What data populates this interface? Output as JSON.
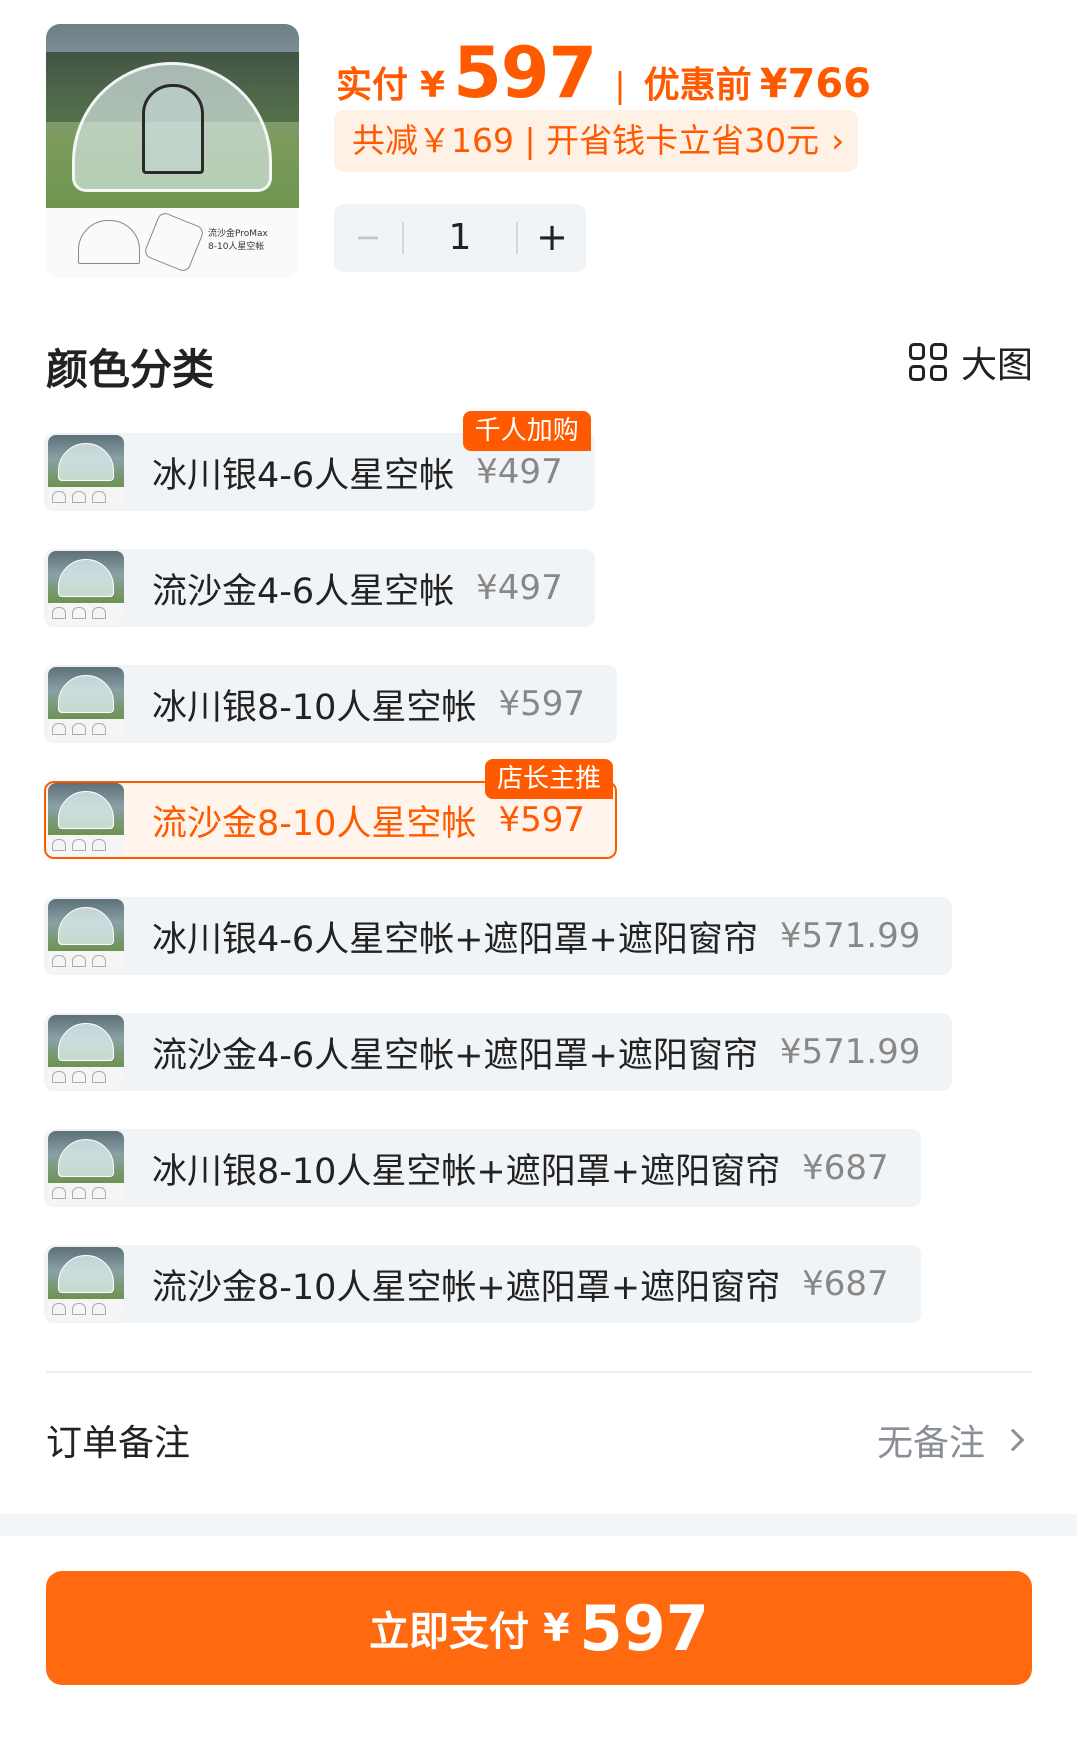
{
  "header": {
    "product_image_caption_line1": "流沙金ProMax",
    "product_image_caption_line2": "8-10人星空帐",
    "paid_label": "实付",
    "currency": "¥",
    "paid_amount": "597",
    "separator": "|",
    "original_label": "优惠前",
    "original_price": "¥766",
    "discount_text": "共减￥169 | 开省钱卡立省30元",
    "discount_chevron": "›",
    "quantity": "1",
    "minus_label": "−",
    "plus_label": "+"
  },
  "section": {
    "title": "颜色分类",
    "big_image_label": "大图",
    "big_image_icon": "grid-icon"
  },
  "options": [
    {
      "name": "冰川银4-6人星空帐",
      "price": "¥497",
      "badge": "千人加购",
      "selected": false
    },
    {
      "name": "流沙金4-6人星空帐",
      "price": "¥497",
      "badge": "",
      "selected": false
    },
    {
      "name": "冰川银8-10人星空帐",
      "price": "¥597",
      "badge": "",
      "selected": false
    },
    {
      "name": "流沙金8-10人星空帐",
      "price": "¥597",
      "badge": "店长主推",
      "selected": true
    },
    {
      "name": "冰川银4-6人星空帐+遮阳罩+遮阳窗帘",
      "price": "¥571.99",
      "badge": "",
      "selected": false
    },
    {
      "name": "流沙金4-6人星空帐+遮阳罩+遮阳窗帘",
      "price": "¥571.99",
      "badge": "",
      "selected": false
    },
    {
      "name": "冰川银8-10人星空帐+遮阳罩+遮阳窗帘",
      "price": "¥687",
      "badge": "",
      "selected": false
    },
    {
      "name": "流沙金8-10人星空帐+遮阳罩+遮阳窗帘",
      "price": "¥687",
      "badge": "",
      "selected": false
    }
  ],
  "remark": {
    "label": "订单备注",
    "value": "无备注"
  },
  "pay_button": {
    "label": "立即支付",
    "currency": "¥",
    "amount": "597"
  },
  "colors": {
    "accent": "#ff5a00",
    "button": "#ff6a10",
    "chip_bg": "#fff1e6",
    "option_bg": "#f1f4f7"
  }
}
